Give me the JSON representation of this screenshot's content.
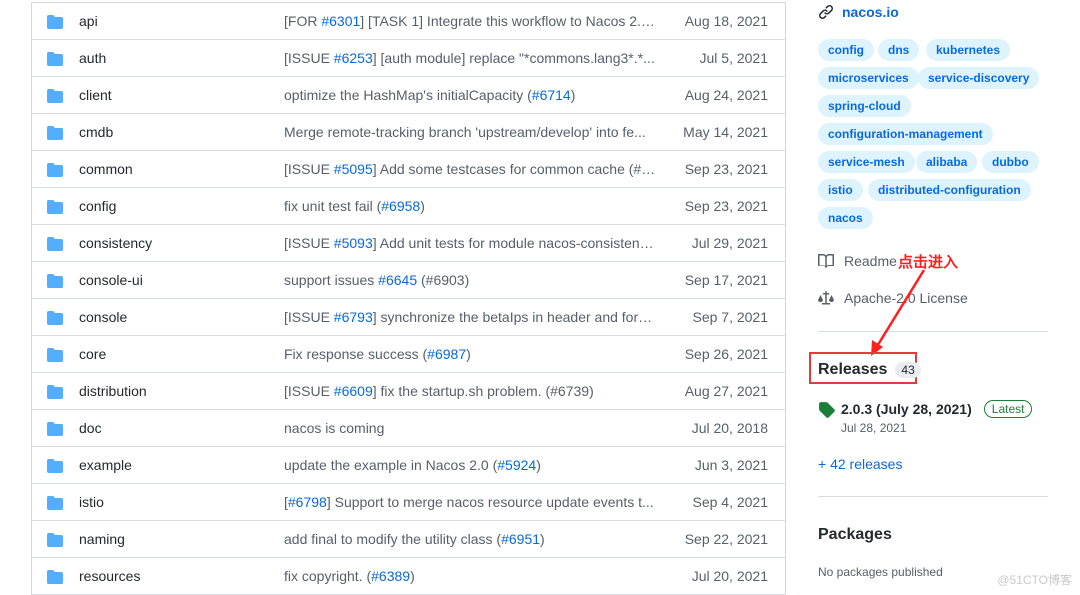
{
  "files": [
    {
      "name": "api",
      "msg_pre": "[FOR ",
      "link": "#6301",
      "msg_post": "] [TASK 1] Integrate this workflow to Nacos 2.0...",
      "date": "Aug 18, 2021"
    },
    {
      "name": "auth",
      "msg_pre": "[ISSUE ",
      "link": "#6253",
      "msg_post": "] [auth module] replace \"*commons.lang3*.*...",
      "date": "Jul 5, 2021"
    },
    {
      "name": "client",
      "msg_pre": "optimize the HashMap's initialCapacity (",
      "link": "#6714",
      "msg_post": ")",
      "date": "Aug 24, 2021"
    },
    {
      "name": "cmdb",
      "msg_pre": "Merge remote-tracking branch 'upstream/develop' into fe...",
      "link": "",
      "msg_post": "",
      "date": "May 14, 2021"
    },
    {
      "name": "common",
      "msg_pre": "[ISSUE ",
      "link": "#5095",
      "msg_post": "] Add some testcases for common cache (#6...",
      "date": "Sep 23, 2021"
    },
    {
      "name": "config",
      "msg_pre": "fix unit test fail (",
      "link": "#6958",
      "msg_post": ")",
      "date": "Sep 23, 2021"
    },
    {
      "name": "consistency",
      "msg_pre": "[ISSUE ",
      "link": "#5093",
      "msg_post": "] Add unit tests for module nacos-consistenc...",
      "date": "Jul 29, 2021"
    },
    {
      "name": "console-ui",
      "msg_pre": "support issues ",
      "link": "#6645",
      "msg_post": " (#6903)",
      "date": "Sep 17, 2021"
    },
    {
      "name": "console",
      "msg_pre": "[ISSUE ",
      "link": "#6793",
      "msg_post": "] synchronize the betaIps in header and form...",
      "date": "Sep 7, 2021"
    },
    {
      "name": "core",
      "msg_pre": "Fix response success (",
      "link": "#6987",
      "msg_post": ")",
      "date": "Sep 26, 2021"
    },
    {
      "name": "distribution",
      "msg_pre": "[ISSUE ",
      "link": "#6609",
      "msg_post": "] fix the startup.sh problem. (#6739)",
      "date": "Aug 27, 2021"
    },
    {
      "name": "doc",
      "msg_pre": "nacos is coming",
      "link": "",
      "msg_post": "",
      "date": "Jul 20, 2018"
    },
    {
      "name": "example",
      "msg_pre": "update the example in Nacos 2.0 (",
      "link": "#5924",
      "msg_post": ")",
      "date": "Jun 3, 2021"
    },
    {
      "name": "istio",
      "msg_pre": "[",
      "link": "#6798",
      "msg_post": "] Support to merge nacos resource update events t...",
      "date": "Sep 4, 2021"
    },
    {
      "name": "naming",
      "msg_pre": "add final to modify the utility class (",
      "link": "#6951",
      "msg_post": ")",
      "date": "Sep 22, 2021"
    },
    {
      "name": "resources",
      "msg_pre": "fix copyright. (",
      "link": "#6389",
      "msg_post": ")",
      "date": "Jul 20, 2021"
    }
  ],
  "sidebar": {
    "website": "nacos.io",
    "topics": [
      "config",
      "dns",
      "kubernetes",
      "microservices",
      "service-discovery",
      "spring-cloud",
      "configuration-management",
      "service-mesh",
      "alibaba",
      "dubbo",
      "istio",
      "distributed-configuration",
      "nacos"
    ],
    "readme": "Readme",
    "annotation": "点击进入",
    "license": "Apache-2.0 License",
    "releases_title": "Releases",
    "releases_count": "43",
    "release_name": "2.0.3 (July 28, 2021)",
    "release_badge": "Latest",
    "release_date": "Jul 28, 2021",
    "more_releases": "+ 42 releases",
    "packages_title": "Packages",
    "packages_text": "No packages published"
  },
  "watermark": "@51CTO博客",
  "colors": {
    "link": "#0969da",
    "folder": "#54aeff",
    "annotation": "#ff1f1f",
    "latest": "#1a7f37"
  }
}
